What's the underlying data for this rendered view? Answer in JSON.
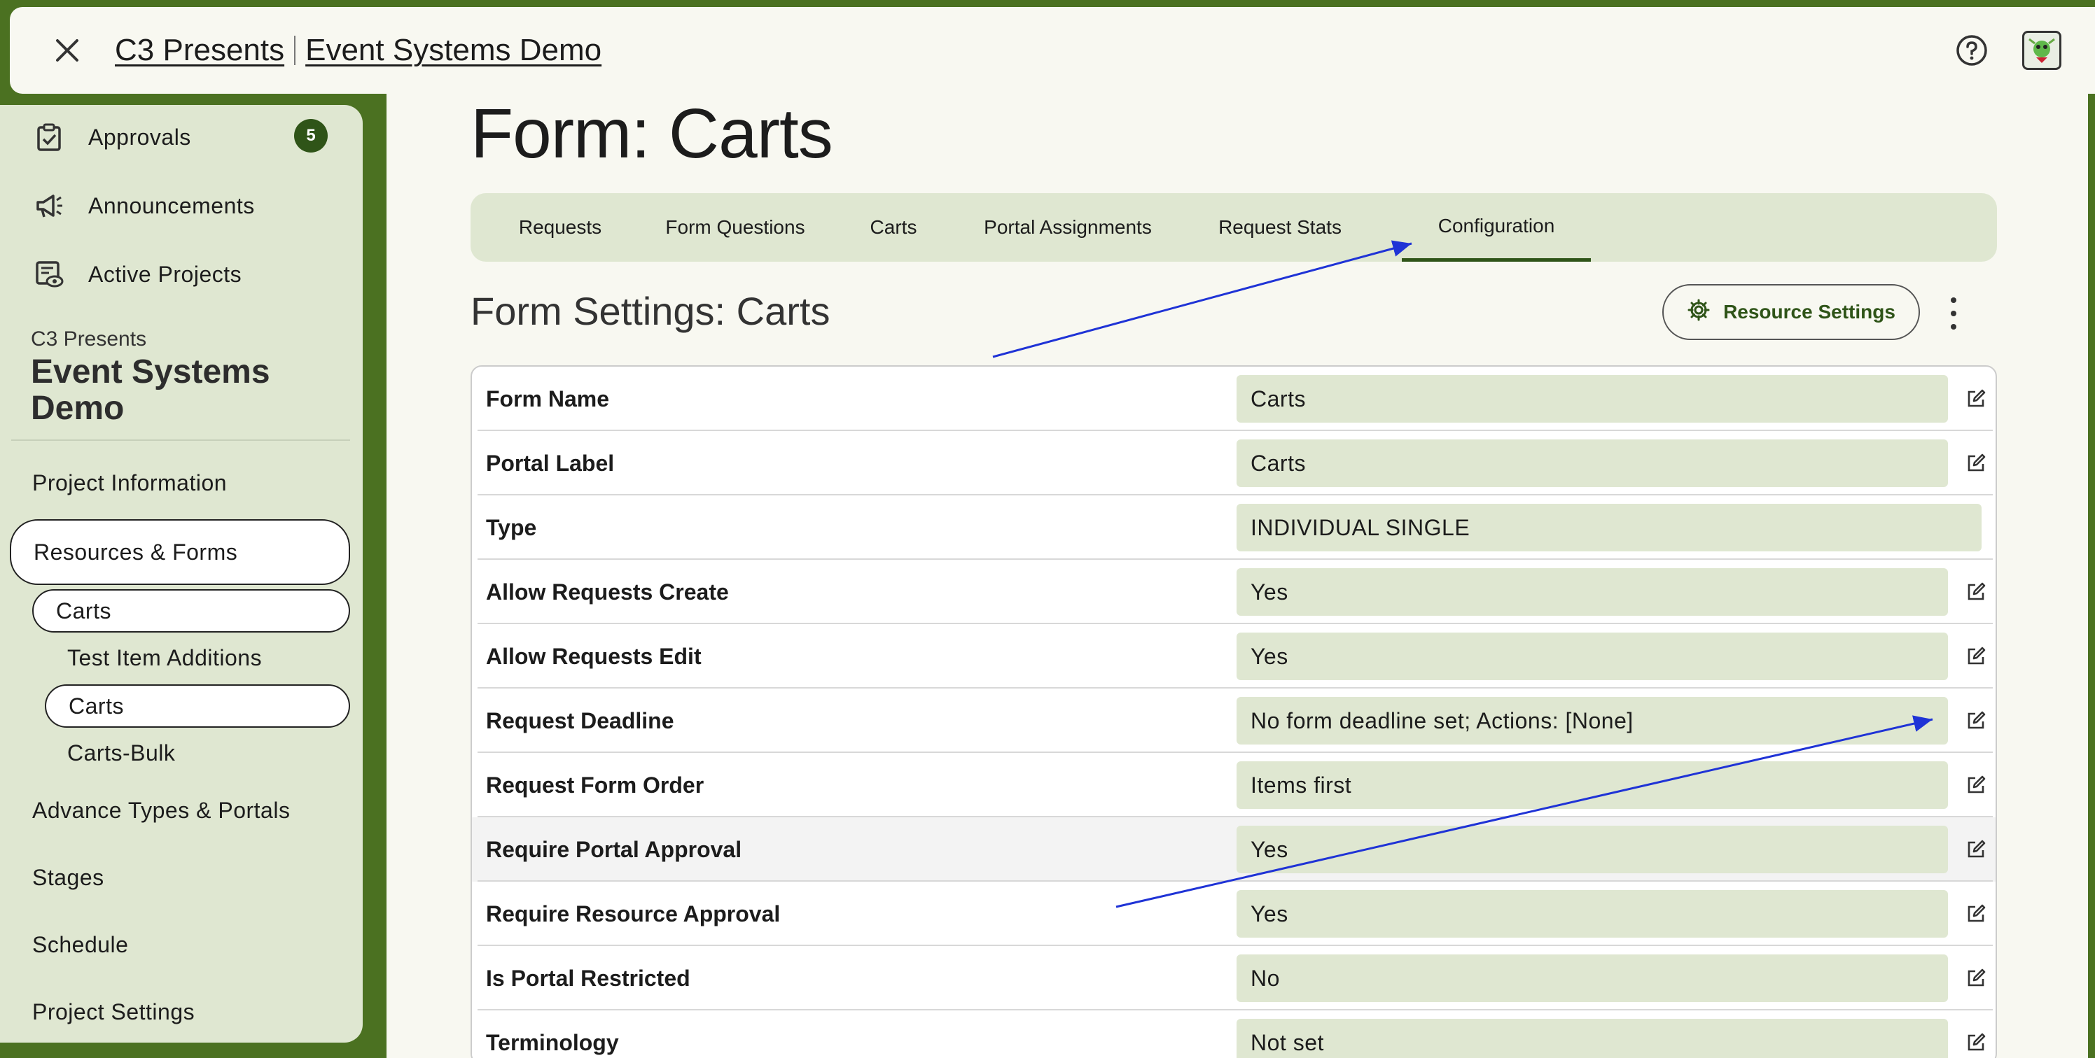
{
  "topbar": {
    "org": "C3 Presents",
    "project": "Event Systems Demo",
    "icons": [
      "close-icon",
      "help-icon",
      "avatar"
    ]
  },
  "sidebar": {
    "nav": [
      {
        "label": "Approvals",
        "icon": "clipboard-check-icon",
        "badge": "5"
      },
      {
        "label": "Announcements",
        "icon": "megaphone-icon"
      },
      {
        "label": "Active Projects",
        "icon": "eye-list-icon"
      }
    ],
    "project_org": "C3 Presents",
    "project_name": "Event Systems Demo",
    "links": {
      "project_information": "Project Information",
      "resources_forms": "Resources & Forms",
      "resource_carts": "Carts",
      "test_item_additions": "Test Item Additions",
      "form_carts": "Carts",
      "carts_bulk": "Carts-Bulk",
      "advance_types": "Advance Types & Portals",
      "stages": "Stages",
      "schedule": "Schedule",
      "project_settings": "Project Settings"
    }
  },
  "main": {
    "title": "Form: Carts",
    "tabs": [
      {
        "label": "Requests"
      },
      {
        "label": "Form Questions"
      },
      {
        "label": "Carts"
      },
      {
        "label": "Portal Assignments"
      },
      {
        "label": "Request Stats"
      },
      {
        "label": "Configuration",
        "active": true
      }
    ],
    "section_title": "Form Settings: Carts",
    "resource_settings_label": "Resource Settings",
    "settings": [
      {
        "label": "Form Name",
        "value": "Carts",
        "editable": true
      },
      {
        "label": "Portal Label",
        "value": "Carts",
        "editable": true
      },
      {
        "label": "Type",
        "value": "INDIVIDUAL SINGLE",
        "editable": false
      },
      {
        "label": "Allow Requests Create",
        "value": "Yes",
        "editable": true
      },
      {
        "label": "Allow Requests Edit",
        "value": "Yes",
        "editable": true
      },
      {
        "label": "Request Deadline",
        "value": "No form deadline set; Actions: [None]",
        "editable": true
      },
      {
        "label": "Request Form Order",
        "value": "Items first",
        "editable": true
      },
      {
        "label": "Require Portal Approval",
        "value": "Yes",
        "editable": true
      },
      {
        "label": "Require Resource Approval",
        "value": "Yes",
        "editable": true
      },
      {
        "label": "Is Portal Restricted",
        "value": "No",
        "editable": true
      },
      {
        "label": "Terminology",
        "value": "Not set",
        "editable": true
      }
    ]
  },
  "colors": {
    "brand_green": "#4b7121",
    "accent_dark_green": "#2f5418",
    "panel_green": "#dfe7d1",
    "annotation_blue": "#1f33d6"
  }
}
